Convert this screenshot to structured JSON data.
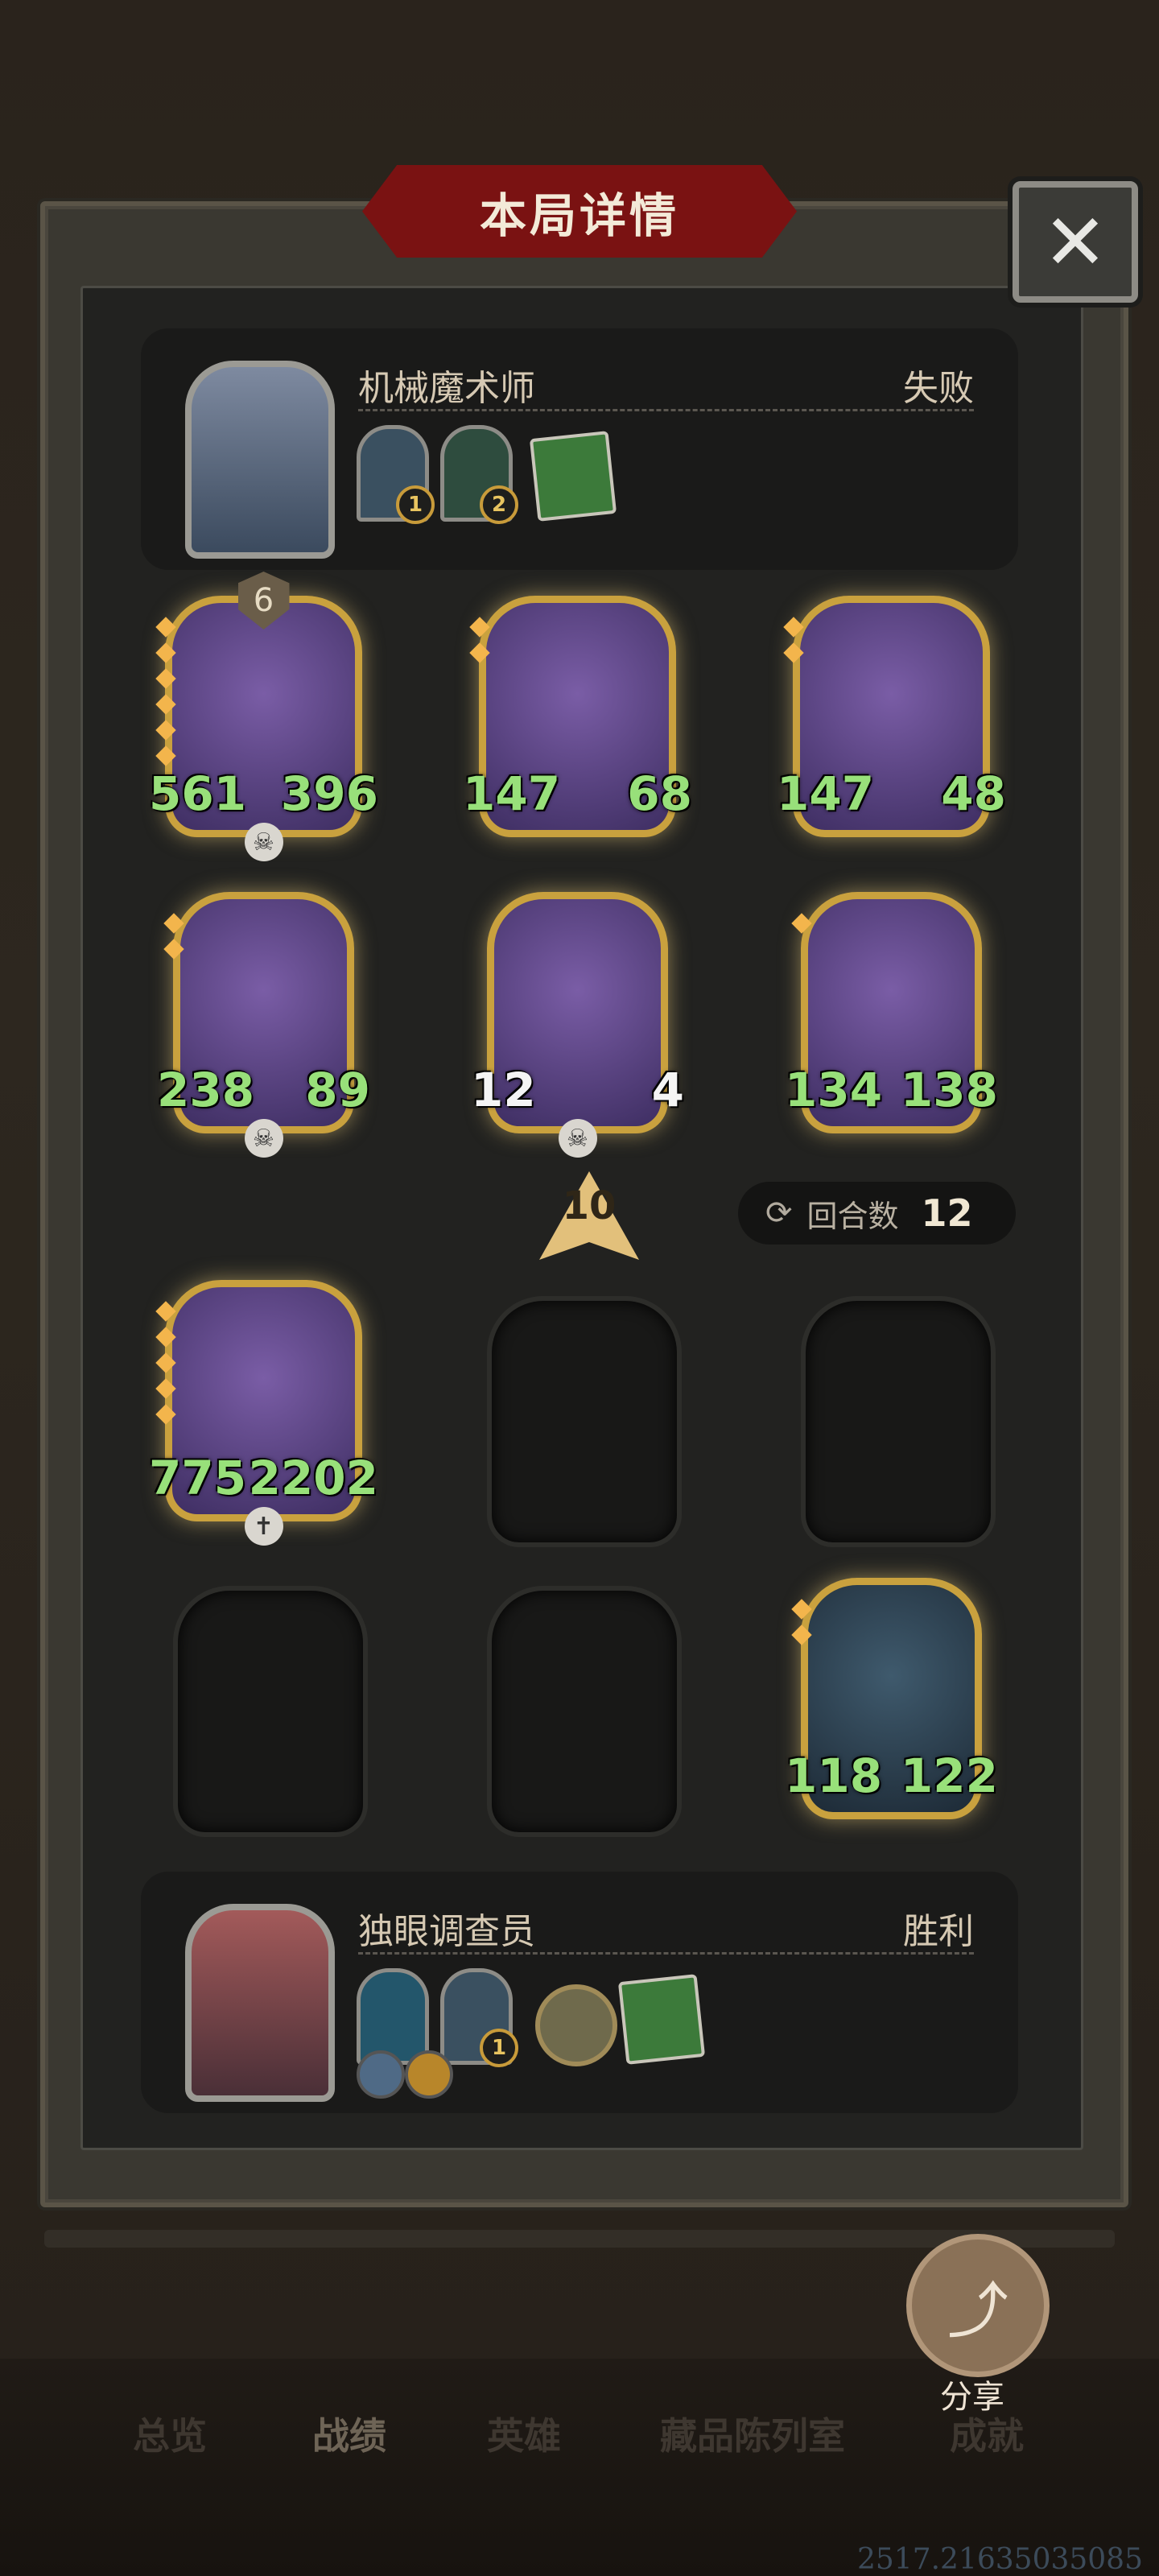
{
  "dialog": {
    "title": "本局详情",
    "close_label": "✕"
  },
  "opponent": {
    "name": "机械魔术师",
    "result": "失败",
    "items": [
      {
        "badge": "1"
      },
      {
        "badge": "2"
      }
    ],
    "book": "book-icon"
  },
  "player": {
    "name": "独眼调查员",
    "result": "胜利",
    "items": [
      {
        "badge": ""
      },
      {
        "badge": "1"
      }
    ],
    "medal": "medal-icon",
    "book": "book-icon"
  },
  "minions": [
    {
      "name": "bearded-brute",
      "attack": "561",
      "health": "396",
      "tier": "6",
      "skull": true
    },
    {
      "name": "jester-clown",
      "attack": "147",
      "health": "68"
    },
    {
      "name": "pirate-captain",
      "attack": "147",
      "health": "48"
    },
    {
      "name": "pig-noble",
      "attack": "238",
      "health": "89",
      "skull": true
    },
    {
      "name": "toy-soldier",
      "attack": "12",
      "health": "4",
      "skull": true
    },
    {
      "name": "sea-serpent",
      "attack": "134",
      "health": "138"
    },
    {
      "name": "black-dragon",
      "attack": "775",
      "health": "2202"
    },
    {
      "name": "orca",
      "attack": "118",
      "health": "122"
    }
  ],
  "level_arrow": "10",
  "round": {
    "label": "回合数",
    "value": "12"
  },
  "share_label": "分享",
  "tabs": [
    {
      "label": "总览"
    },
    {
      "label": "战绩"
    },
    {
      "label": "英雄"
    },
    {
      "label": "藏品陈列室"
    },
    {
      "label": "成就"
    }
  ],
  "footer_code": "2517.21635035085",
  "colors": {
    "accent": "#c9a13e",
    "stat_green": "#98e07a",
    "banner_red": "#7a1212"
  }
}
